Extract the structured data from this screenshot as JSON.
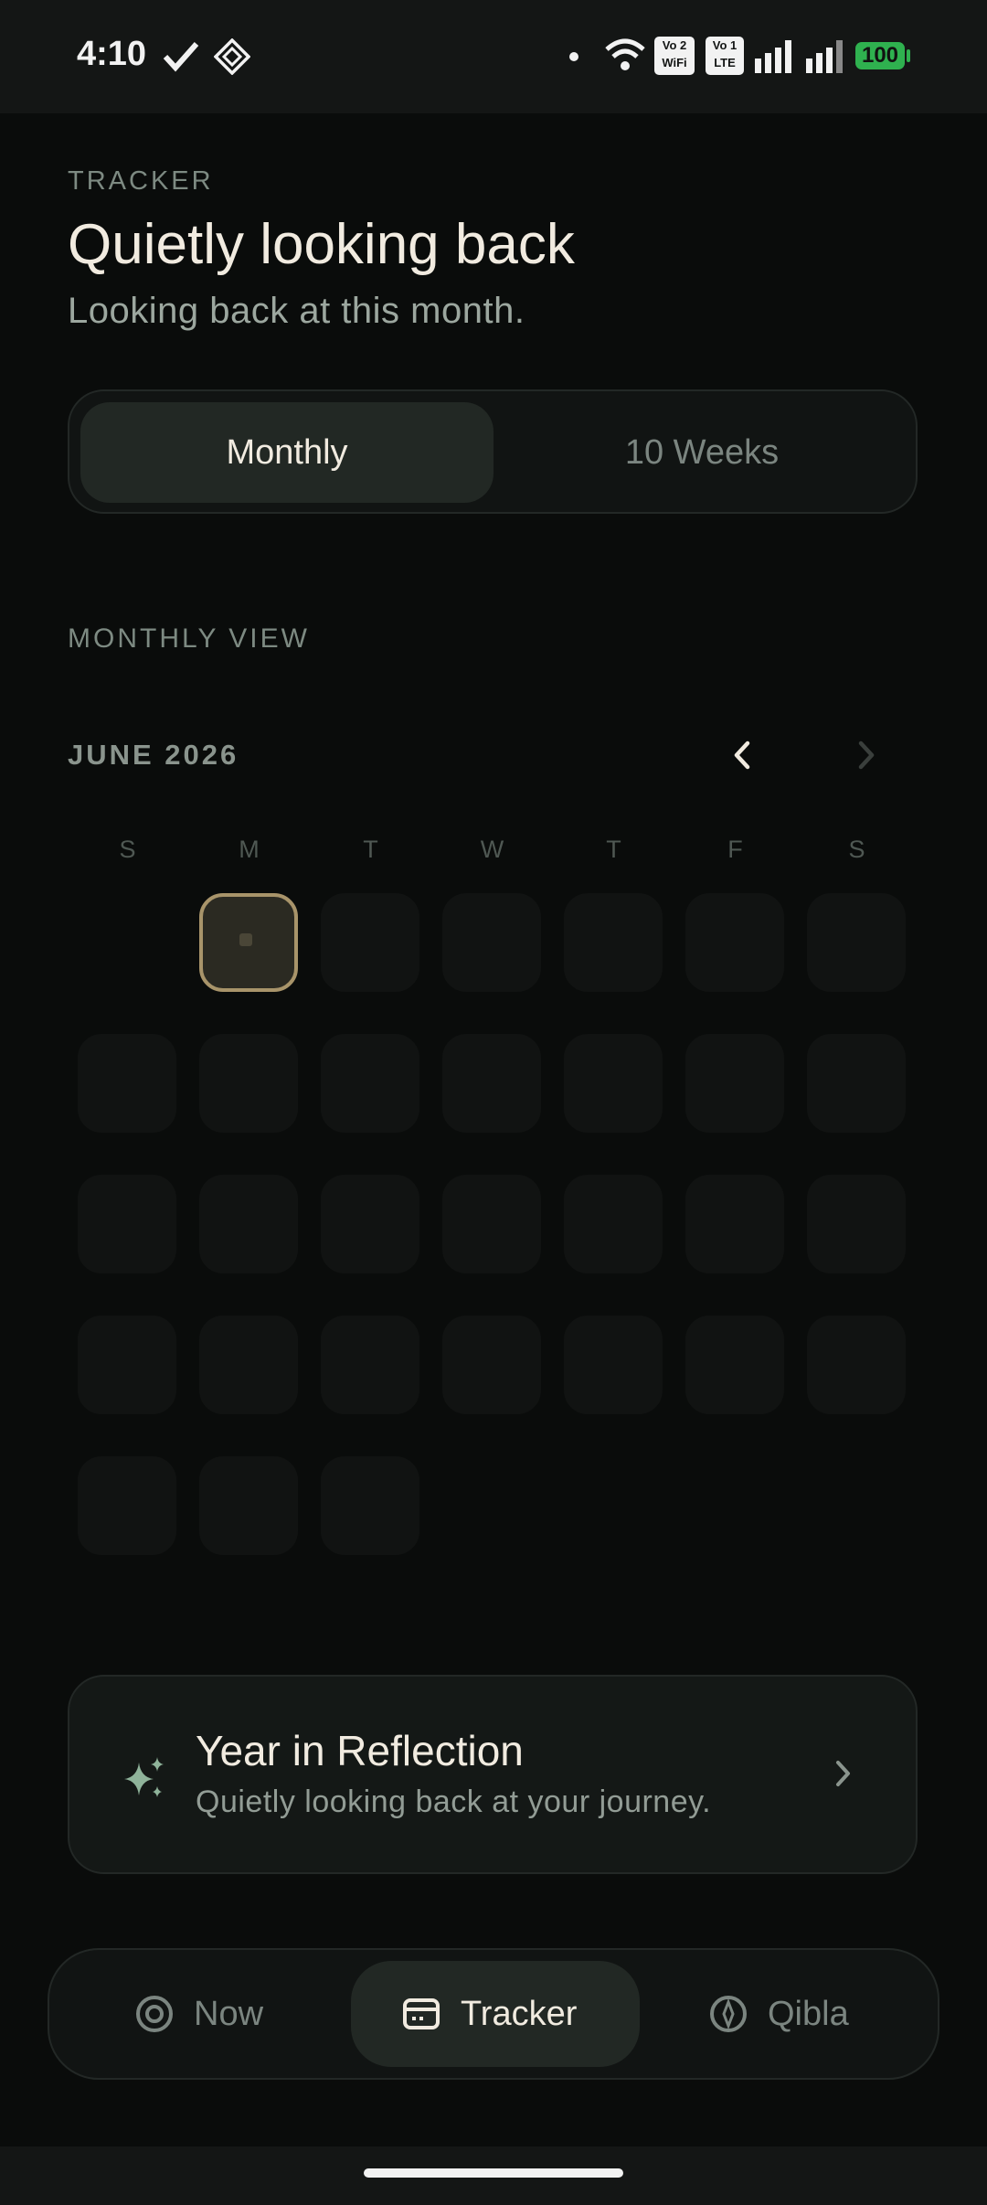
{
  "status_bar": {
    "time": "4:10",
    "battery": "100",
    "volte_wifi": "Vo 2\nWiFi",
    "volte_lte": "Vo 1\nLTE"
  },
  "header": {
    "eyebrow": "TRACKER",
    "title": "Quietly looking back",
    "subtitle": "Looking back at this month."
  },
  "segment": {
    "options": [
      {
        "label": "Monthly",
        "selected": true
      },
      {
        "label": "10 Weeks",
        "selected": false
      }
    ]
  },
  "monthly": {
    "section_label": "MONTHLY VIEW",
    "month_label": "JUNE 2026",
    "weekdays": [
      "S",
      "M",
      "T",
      "W",
      "T",
      "F",
      "S"
    ]
  },
  "reflection_card": {
    "title": "Year in Reflection",
    "subtitle": "Quietly looking back at your journey."
  },
  "tabbar": {
    "tabs": [
      {
        "label": "Now",
        "icon": "target-icon",
        "active": false
      },
      {
        "label": "Tracker",
        "icon": "calendar-card-icon",
        "active": true
      },
      {
        "label": "Qibla",
        "icon": "compass-icon",
        "active": false
      }
    ]
  },
  "colors": {
    "background": "#0a0c0b",
    "accent_gold": "#a8946a",
    "sparkle_green": "#8fb39a"
  }
}
